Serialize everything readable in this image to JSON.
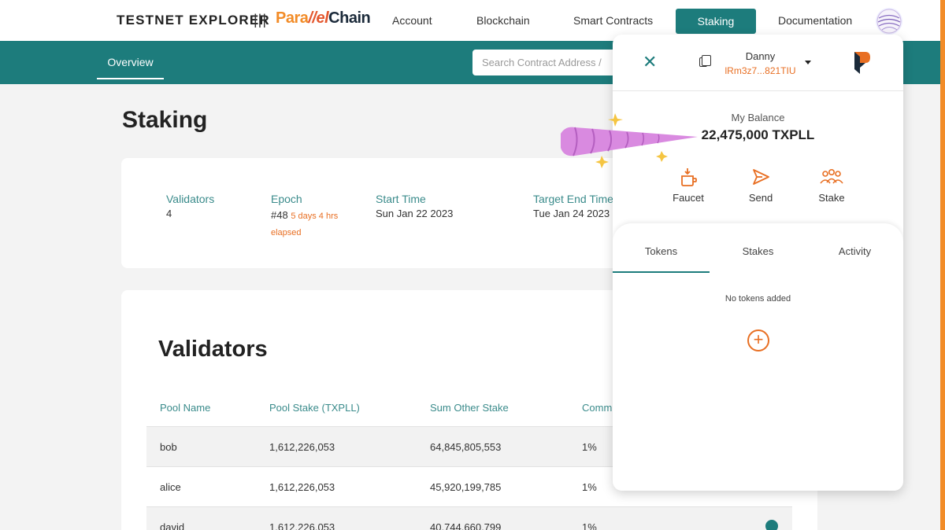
{
  "header": {
    "brand": "TESTNET EXPLORER",
    "separator": "|||",
    "logo_part1": "Para",
    "logo_part2": "//el",
    "logo_part3": "Chain",
    "nav": [
      "Account",
      "Blockchain",
      "Smart Contracts",
      "Staking",
      "Documentation"
    ],
    "active_nav": "Staking"
  },
  "subnav": {
    "overview": "Overview",
    "search_placeholder": "Search Contract Address /"
  },
  "page": {
    "title": "Staking",
    "stats": {
      "validators_label": "Validators",
      "validators_value": "4",
      "epoch_label": "Epoch",
      "epoch_value": "#48",
      "epoch_elapsed_1": "5 days 4 hrs",
      "epoch_elapsed_2": "elapsed",
      "start_label": "Start Time",
      "start_value": "Sun Jan 22 2023",
      "end_label": "Target End Time",
      "end_value": "Tue Jan 24 2023"
    },
    "validators": {
      "title": "Validators",
      "columns": [
        "Pool Name",
        "Pool Stake (TXPLL)",
        "Sum Other Stake",
        "Comm"
      ],
      "rows": [
        {
          "name": "bob",
          "pool_stake": "1,612,226,053",
          "other_stake": "64,845,805,553",
          "comm": "1%"
        },
        {
          "name": "alice",
          "pool_stake": "1,612,226,053",
          "other_stake": "45,920,199,785",
          "comm": "1%"
        },
        {
          "name": "david",
          "pool_stake": "1,612,226,053",
          "other_stake": "40,744,660,799",
          "comm": "1%"
        }
      ]
    }
  },
  "wallet": {
    "account_name": "Danny",
    "address": "lRm3z7...821TIU",
    "balance_label": "My Balance",
    "balance": "22,475,000 TXPLL",
    "actions": {
      "faucet": "Faucet",
      "send": "Send",
      "stake": "Stake"
    },
    "tabs": [
      "Tokens",
      "Stakes",
      "Activity"
    ],
    "active_tab": "Tokens",
    "empty_message": "No tokens added",
    "add_symbol": "+"
  },
  "colors": {
    "teal": "#1d7c7c",
    "orange": "#e86f23",
    "horn_pink": "#d98ae0",
    "sparkle": "#f5c542"
  }
}
